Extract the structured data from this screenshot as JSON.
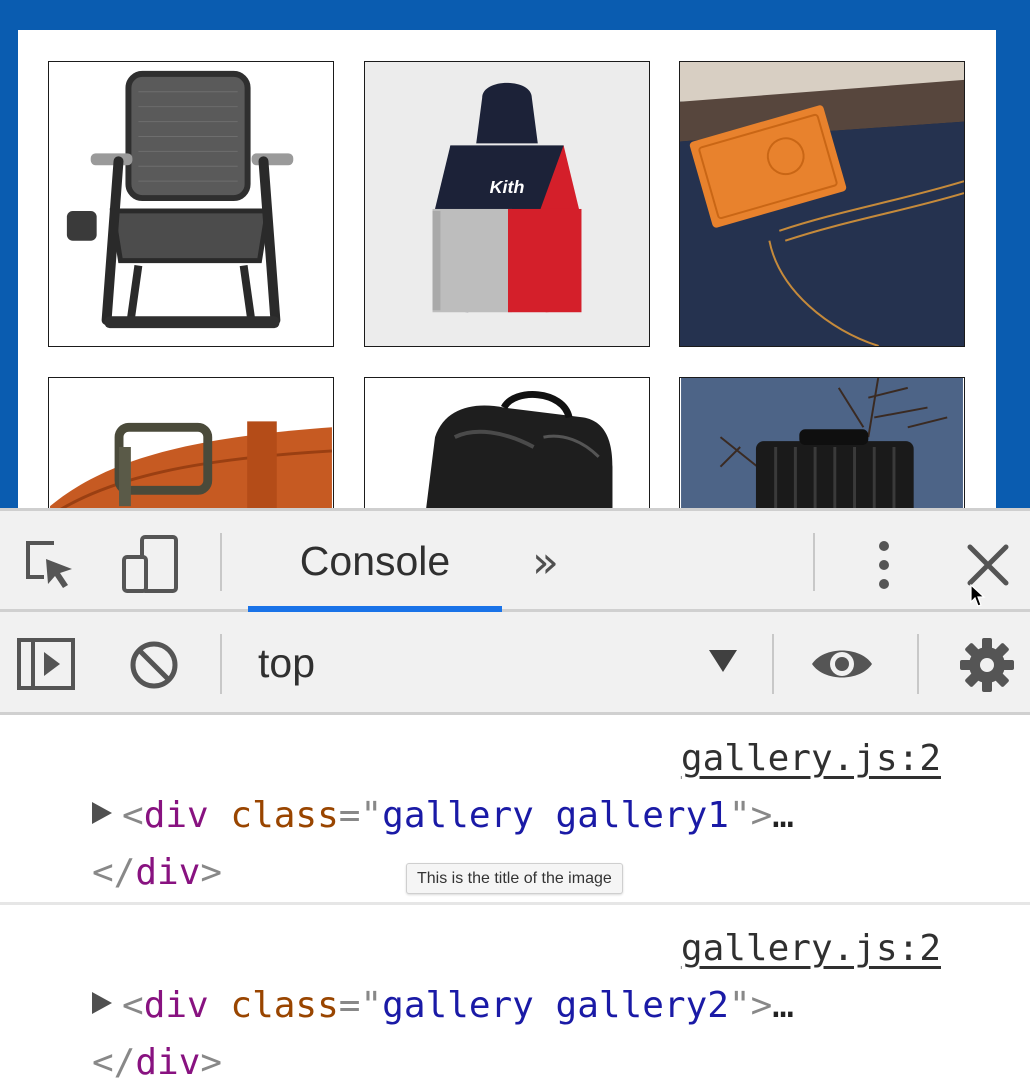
{
  "gallery": {
    "items": [
      {
        "name": "chair"
      },
      {
        "name": "hoodie",
        "print": "Kith"
      },
      {
        "name": "denim"
      },
      {
        "name": "belt"
      },
      {
        "name": "backpack"
      },
      {
        "name": "suitcase"
      }
    ]
  },
  "devtools": {
    "toolbar": {
      "inspect_icon": "inspect-element-icon",
      "device_icon": "device-toolbar-icon",
      "active_tab": "Console",
      "more_tabs": "»",
      "menu_icon": "kebab-menu-icon",
      "close_icon": "close-icon"
    },
    "filter_bar": {
      "sidebar_icon": "sidebar-toggle-icon",
      "clear_icon": "clear-console-icon",
      "context": "top",
      "eye_icon": "live-expression-icon",
      "settings_icon": "gear-icon"
    },
    "messages": [
      {
        "source": "gallery.js:2",
        "tag": "div",
        "attr": "class",
        "value": "gallery gallery1",
        "ellipsis": "…",
        "close_tag": "div"
      },
      {
        "source": "gallery.js:2",
        "tag": "div",
        "attr": "class",
        "value": "gallery gallery2",
        "ellipsis": "…",
        "close_tag": "div"
      }
    ],
    "tooltip": "This is the title of the image"
  },
  "colors": {
    "frame_blue": "#0a5cb0",
    "tab_underline": "#1a73e8",
    "tag_name": "#881280",
    "attr_name": "#994500",
    "attr_value": "#1a1aa6"
  }
}
